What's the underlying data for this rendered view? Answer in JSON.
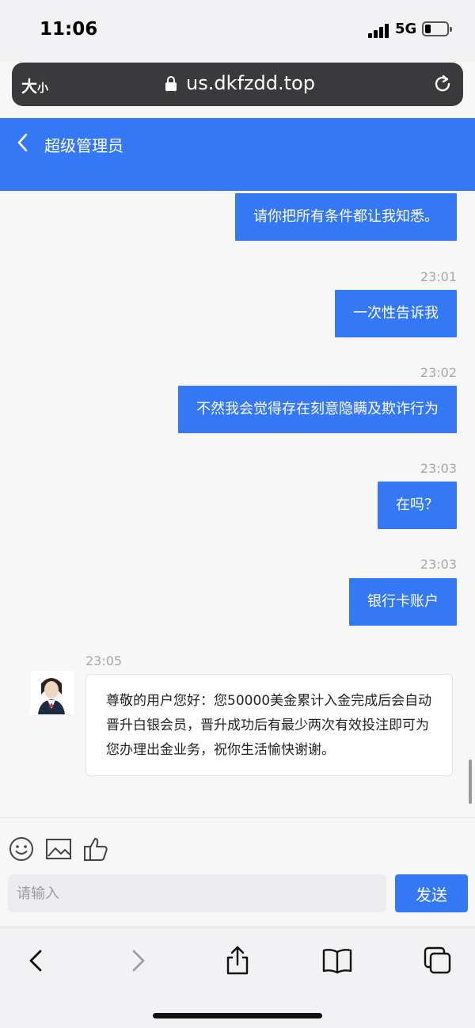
{
  "status_bar": {
    "time": "11:06",
    "network": "5G"
  },
  "browser": {
    "text_size_label": "大",
    "text_size_small": "小",
    "domain": "us.dkfzdd.top"
  },
  "header": {
    "title": "超级管理员"
  },
  "messages": [
    {
      "direction": "out",
      "time": "",
      "text": "请你把所有条件都让我知悉。"
    },
    {
      "direction": "out",
      "time": "23:01",
      "text": "一次性告诉我"
    },
    {
      "direction": "out",
      "time": "23:02",
      "text": "不然我会觉得存在刻意隐瞒及欺诈行为"
    },
    {
      "direction": "out",
      "time": "23:03",
      "text": "在吗？"
    },
    {
      "direction": "out",
      "time": "23:03",
      "text": "银行卡账户"
    },
    {
      "direction": "in",
      "time": "23:05",
      "text": "尊敬的用户您好：您50000美金累计入金完成后会自动晋升白银会员，晋升成功后有最少两次有效投注即可为您办理出金业务，祝你生活愉快谢谢。"
    }
  ],
  "composer": {
    "placeholder": "请输入",
    "send_label": "发送",
    "icons": [
      "emoji-icon",
      "image-icon",
      "thumbs-up-icon"
    ]
  },
  "toolbar": {
    "icons": [
      "back-arrow-icon",
      "forward-arrow-icon",
      "share-icon",
      "bookmarks-icon",
      "tabs-icon"
    ]
  },
  "colors": {
    "accent": "#3478f6",
    "background": "#f7f7f8",
    "timestamp": "#a7a7ab"
  }
}
